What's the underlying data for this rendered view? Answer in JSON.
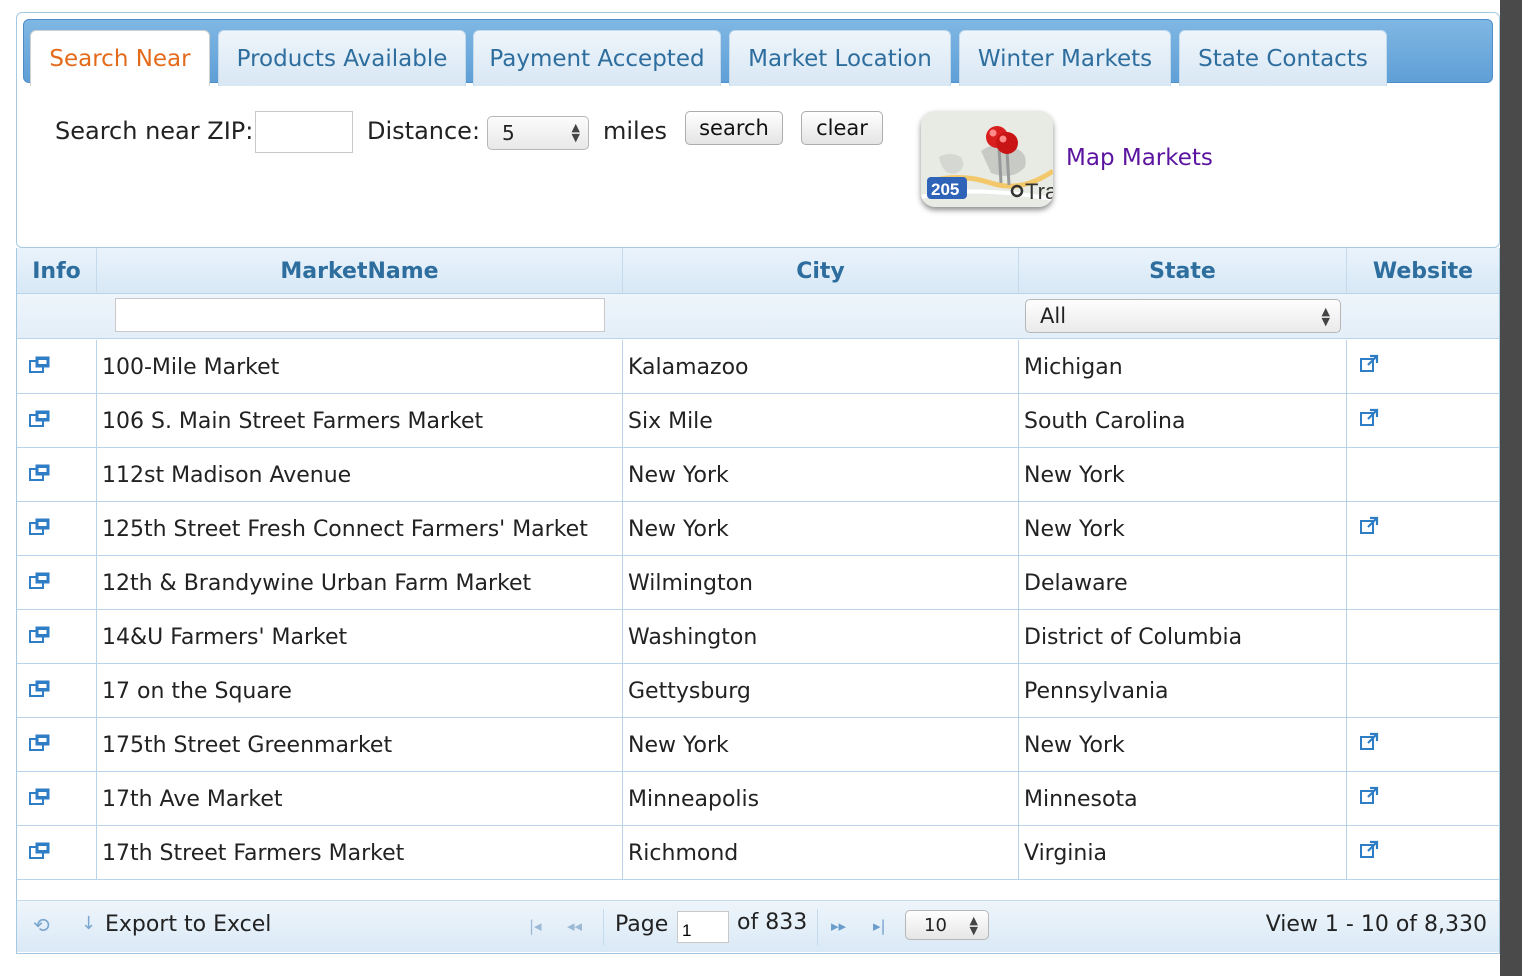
{
  "tabs": [
    {
      "label": "Search Near",
      "active": true
    },
    {
      "label": "Products Available",
      "active": false
    },
    {
      "label": "Payment Accepted",
      "active": false
    },
    {
      "label": "Market Location",
      "active": false
    },
    {
      "label": "Winter Markets",
      "active": false
    },
    {
      "label": "State Contacts",
      "active": false
    }
  ],
  "search": {
    "zip_label": "Search near ZIP:",
    "zip_value": "",
    "distance_label": "Distance:",
    "distance_value": "5",
    "miles_label": "miles",
    "search_button": "search",
    "clear_button": "clear",
    "map_link": "Map Markets",
    "map_icon": "map-pins-icon",
    "map_text_highway": "205",
    "map_text_fragment": "Tra"
  },
  "grid": {
    "columns": [
      "Info",
      "MarketName",
      "City",
      "State",
      "Website"
    ],
    "state_filter": "All",
    "market_filter": "",
    "rows": [
      {
        "name": "100-Mile Market",
        "city": "Kalamazoo",
        "state": "Michigan",
        "website": true
      },
      {
        "name": "106 S. Main Street Farmers Market",
        "city": "Six Mile",
        "state": "South Carolina",
        "website": true
      },
      {
        "name": "112st Madison Avenue",
        "city": "New York",
        "state": "New York",
        "website": false
      },
      {
        "name": "125th Street Fresh Connect Farmers' Market",
        "city": "New York",
        "state": "New York",
        "website": true
      },
      {
        "name": "12th & Brandywine Urban Farm Market",
        "city": "Wilmington",
        "state": "Delaware",
        "website": false
      },
      {
        "name": "14&U Farmers' Market",
        "city": "Washington",
        "state": "District of Columbia",
        "website": false
      },
      {
        "name": "17 on the Square",
        "city": "Gettysburg",
        "state": "Pennsylvania",
        "website": false
      },
      {
        "name": "175th Street Greenmarket",
        "city": "New York",
        "state": "New York",
        "website": true
      },
      {
        "name": "17th Ave Market",
        "city": "Minneapolis",
        "state": "Minnesota",
        "website": true
      },
      {
        "name": "17th Street Farmers Market",
        "city": "Richmond",
        "state": "Virginia",
        "website": true
      }
    ]
  },
  "pager": {
    "export_label": "Export to Excel",
    "page_label": "Page",
    "page_value": "1",
    "of_label": "of 833",
    "rows_per_page": "10",
    "view_label": "View 1 - 10 of 8,330"
  },
  "colors": {
    "header_text": "#2e6e9e",
    "active_tab": "#e36b1b",
    "link": "#5b14a0"
  }
}
